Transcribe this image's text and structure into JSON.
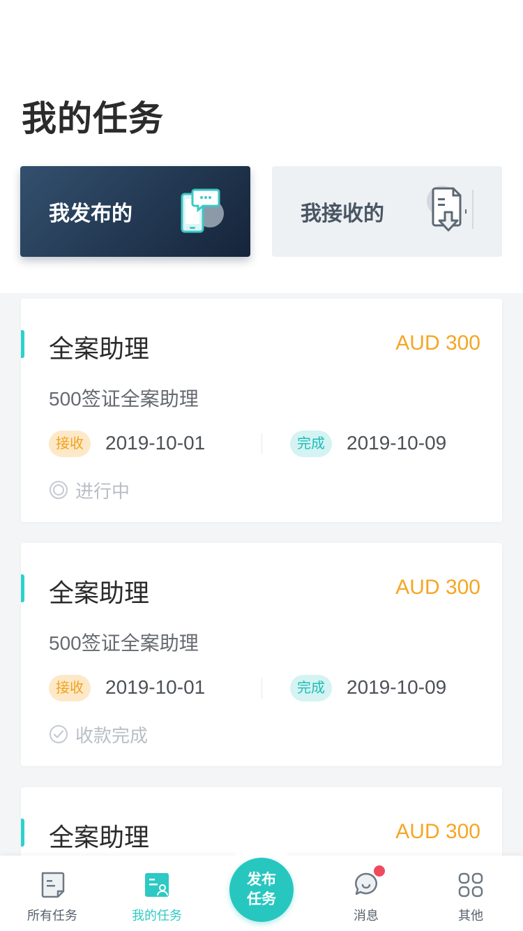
{
  "page": {
    "title": "我的任务"
  },
  "segments": {
    "published": {
      "label": "我发布的",
      "icon": "phone-chat-icon"
    },
    "received": {
      "label": "我接收的",
      "icon": "document-download-icon"
    }
  },
  "cards": [
    {
      "title": "全案助理",
      "price": "AUD 300",
      "description": "500签证全案助理",
      "received_tag": "接收",
      "received_date": "2019-10-01",
      "done_tag": "完成",
      "done_date": "2019-10-09",
      "status": "进行中",
      "status_icon": "in-progress-icon"
    },
    {
      "title": "全案助理",
      "price": "AUD 300",
      "description": "500签证全案助理",
      "received_tag": "接收",
      "received_date": "2019-10-01",
      "done_tag": "完成",
      "done_date": "2019-10-09",
      "status": "收款完成",
      "status_icon": "check-circle-icon"
    },
    {
      "title": "全案助理",
      "price": "AUD 300"
    }
  ],
  "tabbar": {
    "items": [
      {
        "label": "所有任务",
        "icon": "task-list-icon"
      },
      {
        "label": "我的任务",
        "icon": "my-task-icon",
        "active": true
      },
      {
        "label": "消息",
        "icon": "message-icon",
        "badge": true
      },
      {
        "label": "其他",
        "icon": "grid-icon"
      }
    ],
    "publish_button": {
      "line1": "发布",
      "line2": "任务"
    }
  },
  "colors": {
    "accent": "#2ed1cc",
    "price": "#f5a623",
    "segment_active_from": "#33506e",
    "segment_active_to": "#15243a",
    "badge": "#f04a5c"
  }
}
